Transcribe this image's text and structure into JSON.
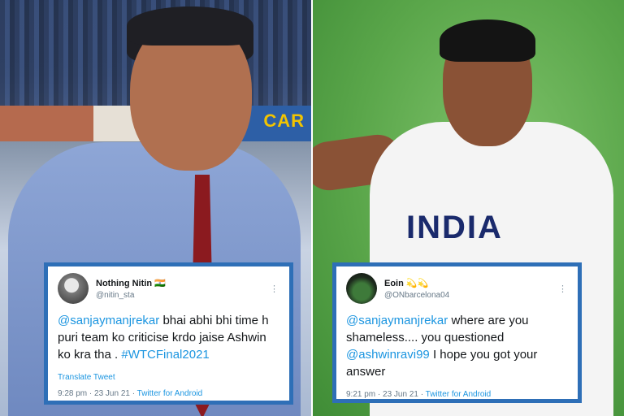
{
  "tweet_left": {
    "display_name": "Nothing Nitin 🇮🇳",
    "handle": "@nitin_sta",
    "menu": "⋮",
    "mention": "@sanjaymanjrekar",
    "text": " bhai abhi bhi time h puri team ko criticise krdo jaise Ashwin ko kra tha . ",
    "hashtag": "#WTCFinal2021",
    "translate": "Translate Tweet",
    "time": "9:28 pm · 23 Jun 21 · ",
    "source": "Twitter for Android"
  },
  "tweet_right": {
    "display_name": "Eoin 💫💫",
    "handle": "@ONbarcelona04",
    "menu": "⋮",
    "mention1": "@sanjaymanjrekar",
    "text1": " where are you shameless.... you questioned ",
    "mention2": "@ashwinravi99",
    "text2": " I hope you got your answer",
    "time": "9:21 pm · 23 Jun 21 · ",
    "source": "Twitter for Android"
  },
  "photo_left_banner": "CAR",
  "photo_right_jersey": "INDIA",
  "colors": {
    "card_border": "#2e6fb7",
    "link": "#1b95e0",
    "muted": "#657786"
  }
}
